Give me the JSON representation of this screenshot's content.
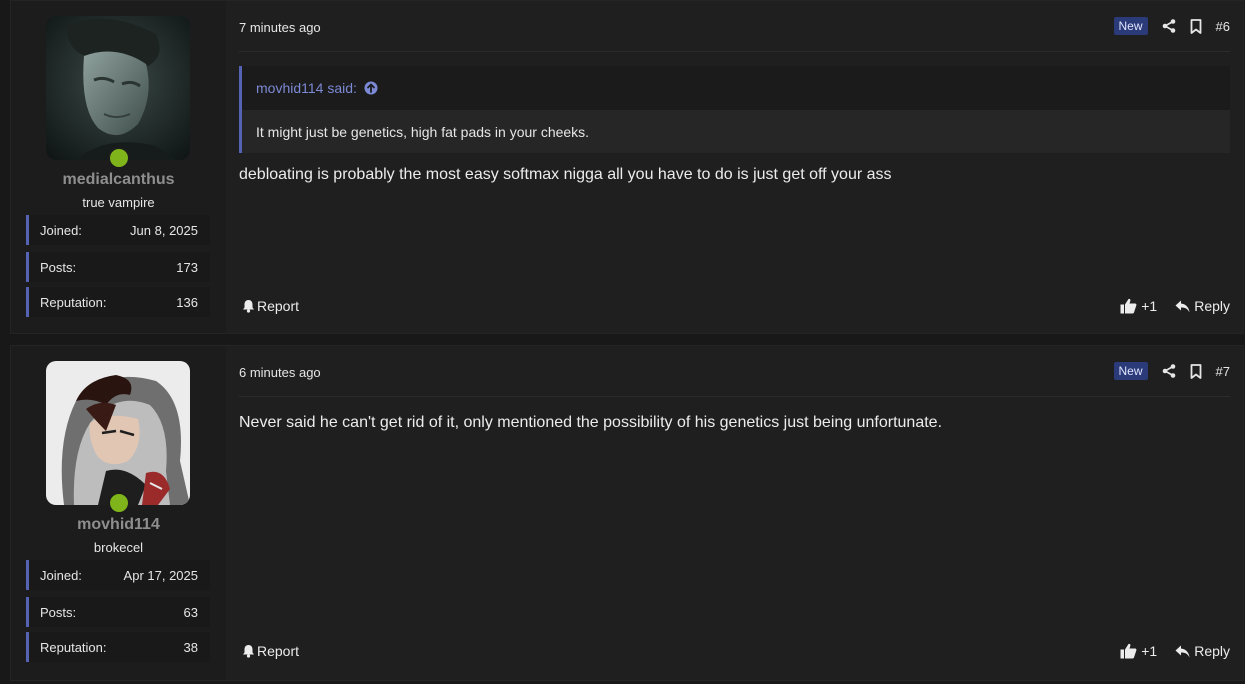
{
  "posts": [
    {
      "user": {
        "name": "medialcanthus",
        "title": "true vampire",
        "avatar_desc": "avatar-photo",
        "stats": [
          {
            "label": "Joined:",
            "value": "Jun 8, 2025"
          },
          {
            "label": "Posts:",
            "value": "173"
          },
          {
            "label": "Reputation:",
            "value": "136"
          }
        ]
      },
      "time": "7 minutes ago",
      "badge": "New",
      "number": "#6",
      "quote": {
        "author": "movhid114 said:",
        "text": "It might just be genetics, high fat pads in your cheeks."
      },
      "message": "debloating is probably the most easy softmax nigga all you have to do is just get off your ass",
      "report_label": "Report",
      "like_label": "+1",
      "reply_label": "Reply"
    },
    {
      "user": {
        "name": "movhid114",
        "title": "brokecel",
        "avatar_desc": "avatar-anime",
        "stats": [
          {
            "label": "Joined:",
            "value": "Apr 17, 2025"
          },
          {
            "label": "Posts:",
            "value": "63"
          },
          {
            "label": "Reputation:",
            "value": "38"
          }
        ]
      },
      "time": "6 minutes ago",
      "badge": "New",
      "number": "#7",
      "message": "Never said he can't get rid of it, only mentioned the possibility of his genetics just being unfortunate.",
      "report_label": "Report",
      "like_label": "+1",
      "reply_label": "Reply"
    }
  ],
  "colors": {
    "accent": "#5463b3",
    "online": "#7fb51a",
    "quote_link": "#7c89d4",
    "badge_bg": "#2b3a78"
  }
}
